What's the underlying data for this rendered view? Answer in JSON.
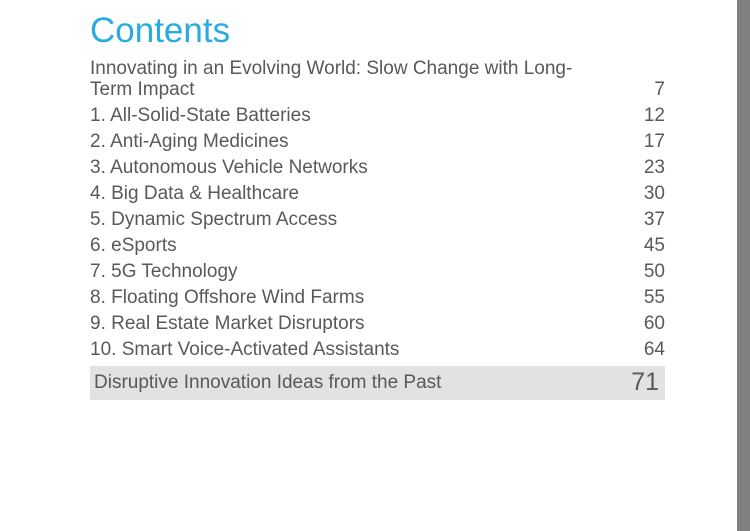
{
  "slide": {
    "title": "Contents",
    "title_color": "#29ABE2",
    "body_color": "#595959",
    "background_color": "#ffffff",
    "highlight_color": "#E2E2E2",
    "edge_bar_color": "#808080"
  },
  "toc": {
    "entries": [
      {
        "label": "Innovating in an Evolving World: Slow Change with Long-Term Impact",
        "page": "7",
        "wrapped": true,
        "highlight": false
      },
      {
        "label": "1. All-Solid-State Batteries",
        "page": "12",
        "wrapped": false,
        "highlight": false
      },
      {
        "label": "2. Anti-Aging Medicines",
        "page": "17",
        "wrapped": false,
        "highlight": false
      },
      {
        "label": "3. Autonomous Vehicle Networks",
        "page": "23",
        "wrapped": false,
        "highlight": false
      },
      {
        "label": "4. Big Data & Healthcare",
        "page": "30",
        "wrapped": false,
        "highlight": false
      },
      {
        "label": "5. Dynamic Spectrum Access",
        "page": "37",
        "wrapped": false,
        "highlight": false
      },
      {
        "label": "6. eSports",
        "page": "45",
        "wrapped": false,
        "highlight": false
      },
      {
        "label": "7. 5G Technology",
        "page": "50",
        "wrapped": false,
        "highlight": false
      },
      {
        "label": "8. Floating Offshore Wind Farms",
        "page": "55",
        "wrapped": false,
        "highlight": false
      },
      {
        "label": "9. Real Estate Market Disruptors",
        "page": "60",
        "wrapped": false,
        "highlight": false
      },
      {
        "label": "10. Smart Voice-Activated Assistants",
        "page": "64",
        "wrapped": false,
        "highlight": false
      },
      {
        "label": "Disruptive Innovation Ideas from the Past",
        "page": "71",
        "wrapped": false,
        "highlight": true
      }
    ]
  }
}
